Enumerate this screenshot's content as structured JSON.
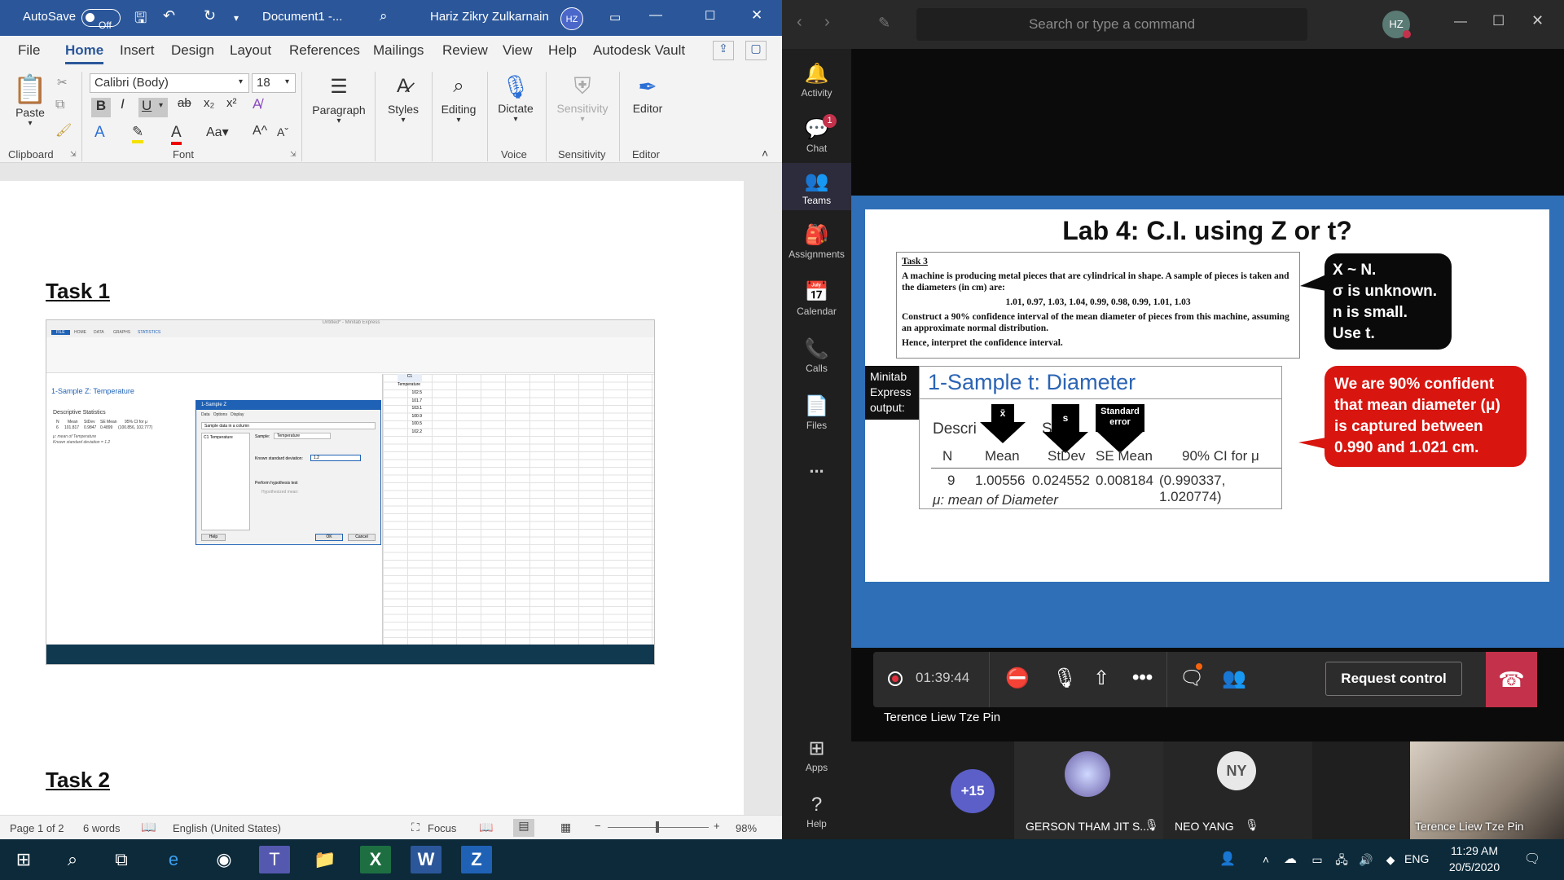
{
  "word": {
    "autosave_label": "AutoSave",
    "autosave_state": "Off",
    "doc_title": "Document1 -...",
    "user_name": "Hariz Zikry Zulkarnain",
    "user_initials": "HZ",
    "menu": [
      "File",
      "Home",
      "Insert",
      "Design",
      "Layout",
      "References",
      "Mailings",
      "Review",
      "View",
      "Help",
      "Autodesk Vault"
    ],
    "active_menu": "Home",
    "ribbon": {
      "paste": "Paste",
      "font_name": "Calibri (Body)",
      "font_size": "18",
      "paragraph": "Paragraph",
      "styles": "Styles",
      "editing": "Editing",
      "dictate": "Dictate",
      "sensitivity": "Sensitivity",
      "editor": "Editor",
      "groups": {
        "clipboard": "Clipboard",
        "font": "Font",
        "voice": "Voice",
        "sensitivity": "Sensitivity",
        "editor": "Editor"
      }
    },
    "document": {
      "task1": "Task 1",
      "task2": "Task 2"
    },
    "minitab": {
      "title": "Untitled* - Minitab Express",
      "tabs": [
        "FILE",
        "HOME",
        "DATA",
        "GRAPHS",
        "STATISTICS"
      ],
      "result_title": "1-Sample Z: Temperature",
      "desc_stats": "Descriptive Statistics",
      "stat_headers": [
        "N",
        "Mean",
        "StDev",
        "SE Mean",
        "95% CI for μ"
      ],
      "stat_values": [
        "6",
        "101.817",
        "0.9847",
        "0.4899",
        "(100.856, 102.777)"
      ],
      "note1": "μ: mean of Temperature",
      "note2": "Known standard deviation = 1.2",
      "dialog_title": "1-Sample Z",
      "dialog_tabs": [
        "Data",
        "Options",
        "Display"
      ],
      "dialog_select": "Sample data in a column",
      "dialog_var": "C1 Temperature",
      "dialog_sample_label": "Sample:",
      "dialog_sample_value": "Temperature",
      "dialog_sd_label": "Known standard deviation:",
      "dialog_sd_value": "1.2",
      "dialog_check": "Perform hypothesis test",
      "dialog_hyp": "Hypothesized mean:",
      "dialog_help": "Help",
      "dialog_ok": "OK",
      "dialog_cancel": "Cancel",
      "col_header": "C1",
      "col_name": "Temperature",
      "col_values": [
        "102.5",
        "101.7",
        "103.1",
        "100.9",
        "100.5",
        "102.2"
      ]
    },
    "status": {
      "page": "Page 1 of 2",
      "words": "6 words",
      "language": "English (United States)",
      "focus": "Focus",
      "zoom": "98%"
    }
  },
  "teams": {
    "search_placeholder": "Search or type a command",
    "user_initials": "HZ",
    "rail": [
      {
        "label": "Activity",
        "icon": "bell-icon"
      },
      {
        "label": "Chat",
        "icon": "chat-icon",
        "badge": "1"
      },
      {
        "label": "Teams",
        "icon": "teams-icon"
      },
      {
        "label": "Assignments",
        "icon": "assignments-icon"
      },
      {
        "label": "Calendar",
        "icon": "calendar-icon"
      },
      {
        "label": "Calls",
        "icon": "phone-icon"
      },
      {
        "label": "Files",
        "icon": "files-icon"
      },
      {
        "label": "...",
        "icon": "more-icon"
      },
      {
        "label": "Apps",
        "icon": "apps-icon"
      },
      {
        "label": "Help",
        "icon": "help-icon"
      }
    ],
    "slide": {
      "title": "Lab 4: C.I. using Z or t?",
      "task_heading": "Task 3",
      "task_text1": "A machine is producing metal pieces that are cylindrical in shape.  A sample of pieces is taken and the diameters (in cm) are:",
      "task_data": "1.01, 0.97, 1.03, 1.04, 0.99, 0.98, 0.99, 1.01, 1.03",
      "task_text2": "Construct a 90% confidence interval of the mean diameter of pieces from this machine, assuming an approximate normal distribution.",
      "task_text3": "Hence, interpret the confidence interval.",
      "bubble_black": [
        "X ~ N.",
        "σ is unknown.",
        "n is small.",
        "Use t."
      ],
      "bubble_red": "We are 90% confident that mean diameter (μ) is captured between 0.990 and 1.021 cm.",
      "minitab_label": "Minitab Express output:",
      "output_title": "1-Sample t: Diameter",
      "desc_partial": "Descri",
      "desc_partial2": "Stati",
      "arrow_labels": [
        "x̄",
        "s",
        "Standard error"
      ],
      "headers": [
        "N",
        "Mean",
        "StDev",
        "SE Mean",
        "90% CI for μ"
      ],
      "values": [
        "9",
        "1.00556",
        "0.024552",
        "0.008184",
        "(0.990337, 1.020774)"
      ],
      "footnote": "μ: mean of Diameter"
    },
    "call": {
      "timer": "01:39:44",
      "request_control": "Request control",
      "presenter": "Terence Liew Tze Pin"
    },
    "participants": {
      "more_count": "+15",
      "p1": "GERSON THAM JIT S...",
      "p2": "NEO YANG",
      "p2_initials": "NY",
      "p3": "Terence Liew Tze Pin"
    }
  },
  "taskbar": {
    "language": "ENG",
    "time": "11:29 AM",
    "date": "20/5/2020"
  }
}
